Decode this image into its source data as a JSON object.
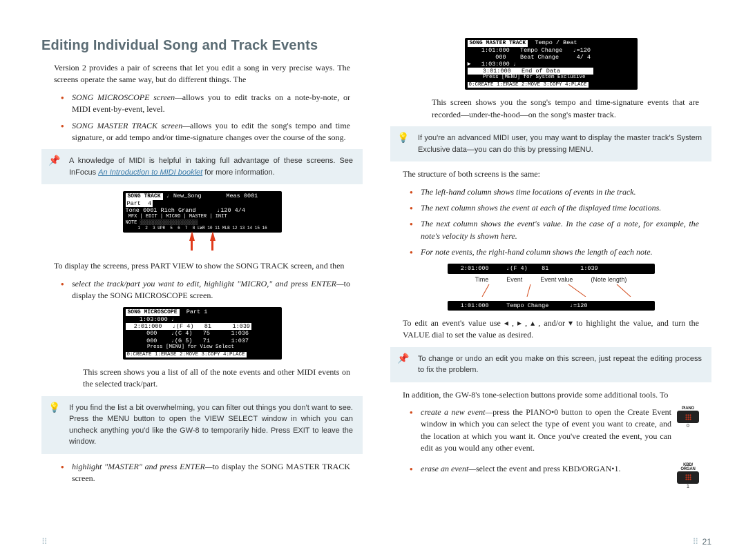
{
  "title": "Editing Individual Song and Track Events",
  "left": {
    "intro": "Version 2 provides a pair of screens that let you edit a song in very precise ways. The screens operate the same way, but do different things. The",
    "bul1_a": "SONG MICROSCOPE screen—",
    "bul1_b": "allows you to edit tracks on a note-by-note, or MIDI event-by-event, level.",
    "bul2_a": "SONG MASTER TRACK screen—",
    "bul2_b": "allows you to edit the song's tempo and time signature, or add tempo and/or time-signature changes over the course of the song.",
    "note1": "A knowledge of MIDI is helpful in taking full advantage of these screens. See InFocus ",
    "note1_link": "An Introduction to MIDI booklet",
    "note1_after": " for more information.",
    "lcd_song_track": {
      "title": "SONG TRACK",
      "name": "New_Song",
      "meas": "Meas 0001",
      "part": "Part  4",
      "tone": "Tone 0001 Rich Grand",
      "tempo": "♩120 4/4",
      "tabs": " MFX | EDIT | MICRO | MASTER | INIT ",
      "grid": "NOTE ░░░░░░░░░░░░░░░░░░░░",
      "nums": "     1  2  3 UPR  5  6  7  8 LWR 10 11 MLB 12 13 14 15 16"
    },
    "p_display": "To display the screens, press PART VIEW to show the SONG TRACK screen, and then",
    "bul3_a": "select the track/part you want to edit, highlight \"MICRO,\" and press ENTER—",
    "bul3_b": "to display the SONG MICROSCOPE screen.",
    "lcd_microscope": {
      "title": "SONG MICROSCOPE",
      "part": "Part 1",
      "r1": "    1:03:000 ♩                      ",
      "r2": "  2:01:000   ♩(F 4)   81      1:039",
      "r3": "      000    ♩(C 4)   75      1:036",
      "r4": "      000    ♩(G 5)   71      1:037",
      "r5": "       Press [MENU] for View Select",
      "foot": "0:CREATE 1:ERASE 2:MOVE 3:COPY 4:PLACE"
    },
    "p_listshows": "This screen shows you a list of all of the note events and other MIDI events on the selected track/part.",
    "note2": "If you find the list a bit overwhelming, you can filter out things you don't want to see. Press the MENU button to open the VIEW SELECT window in which you can uncheck anything you'd like the GW-8 to temporarily hide. Press EXIT to leave the window.",
    "bul4_a": "highlight \"MASTER\" and press ENTER—",
    "bul4_b": "to display the SONG MASTER TRACK screen."
  },
  "right": {
    "lcd_master": {
      "title": "SONG MASTER TRACK",
      "sub": "Tempo / Beat",
      "r1": "    1:01:000   Tempo Change   ♩=120",
      "r2": "        000    Beat Change     4/ 4",
      "r3": "►   1:03:000 ♩                     ",
      "r4": "    3:01:000   End of Data         ",
      "r5": "     Press [MENU] for System Exclusive",
      "foot": "0:CREATE 1:ERASE 2:MOVE 3:COPY 4:PLACE"
    },
    "p_master": "This screen shows you the song's tempo and time-signature events that are recorded—under-the-hood—on the song's master track.",
    "note3": "If you're an advanced MIDI user, you may want to display the master track's System Exclusive data—you can do this by pressing MENU.",
    "p_struct": "The structure of both screens is the same:",
    "s1": "The left-hand column shows time locations of events in the track.",
    "s2": "The next column shows the event at each of the displayed time locations.",
    "s3": "The next column shows the event's value. In the case of a note, for example, the note's velocity is shown here.",
    "s4": "For note events, the right-hand column shows the length of each note.",
    "expl": {
      "time": "Time",
      "event": "Event",
      "eventval": "Event value",
      "notelen": "(Note length)"
    },
    "lcd_row_top": "   2:01:000     ♩(F 4)    81         1:039",
    "lcd_row_bot": "   1:01:000     Tempo Change      ♩=120",
    "p_edit": "To edit an event's value use  ◂ ,  ▸ ,  ▴ , and/or  ▾  to highlight the value, and turn the VALUE dial to set the value as desired.",
    "note4": "To change or undo an edit you make on this screen, just repeat the editing process to fix the problem.",
    "p_addl": "In addition, the GW-8's tone-selection buttons provide some additional tools. To",
    "bul5_a": "create a new event—",
    "bul5_b": "press the PIANO•0 button to open the Create Event window in which you can select the type of event you want to create, and the location at which you want it. Once you've created the event, you can edit as you would any other event.",
    "bul6_a": "erase an event—",
    "bul6_b": "select the event and press KBD/ORGAN•1.",
    "btn_piano": {
      "top": "PIANO",
      "num": "0"
    },
    "btn_kbd": {
      "top": "KBD/\nORGAN",
      "num": "1"
    }
  },
  "page_num": "21"
}
